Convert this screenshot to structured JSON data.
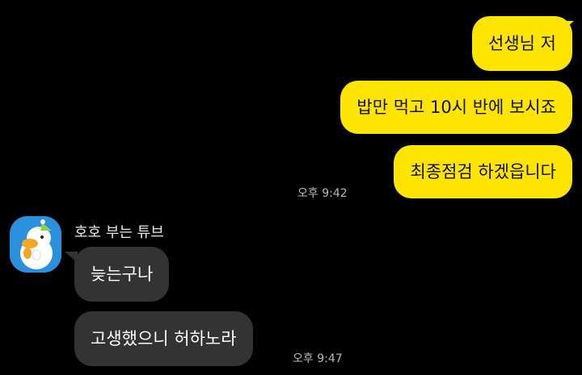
{
  "outgoing": [
    {
      "text": "선생님 저"
    },
    {
      "text": "밥만 먹고 10시 반에 보시죠"
    },
    {
      "text": "최종점검 하겠읍니다"
    }
  ],
  "outgoing_time": "오후 9:42",
  "sender_name": "호호 부는 튜브",
  "avatar_icon": "tube-duck-avatar-icon",
  "incoming": [
    {
      "text": "늦는구나"
    },
    {
      "text": "고생했으니 허하노라"
    }
  ],
  "incoming_time": "오후 9:47",
  "colors": {
    "background": "#000000",
    "outgoing_bubble": "#FEE500",
    "incoming_bubble": "#333333",
    "avatar_bg": "#2A8FDC"
  }
}
